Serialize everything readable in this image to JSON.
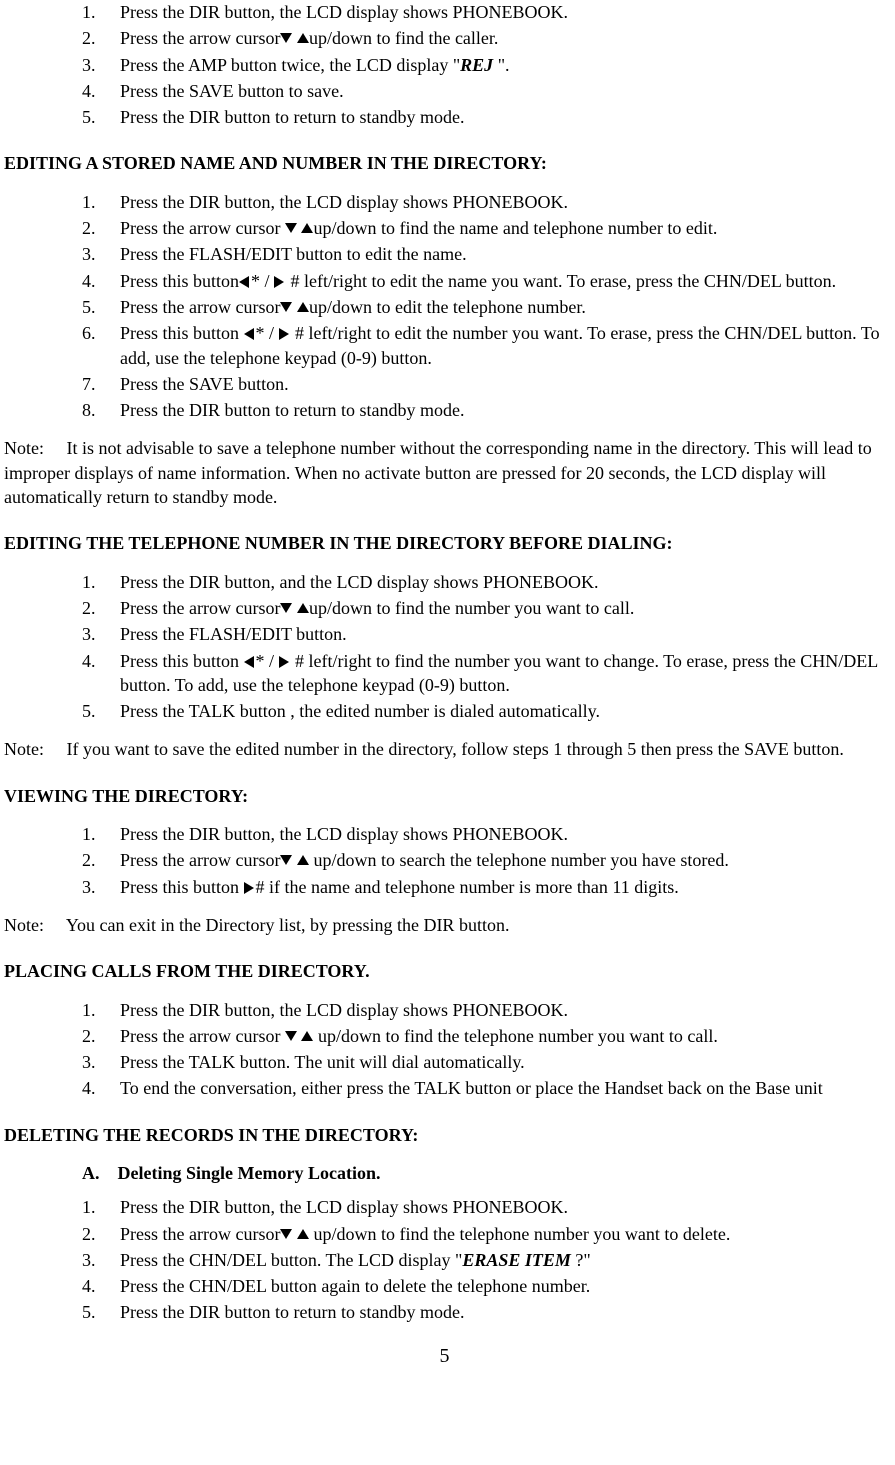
{
  "intro_list": [
    "Press the DIR button, the LCD display shows PHONEBOOK.",
    {
      "pre": "Press the arrow cursor",
      "arrows": "ud",
      "post": "up/down to find the caller."
    },
    {
      "pre": "Press the AMP button twice, the LCD display \"",
      "rej": "REJ",
      "post": " \"."
    },
    "Press the SAVE button to save.",
    "Press the DIR button to return to standby mode."
  ],
  "h1": "EDITING A STORED NAME AND NUMBER IN THE DIRECTORY:",
  "list1": [
    "Press the DIR button, the LCD display shows PHONEBOOK.",
    {
      "pre": "Press the arrow cursor ",
      "arrows": "ud",
      "post": "up/down to find the name and telephone number to edit."
    },
    "Press the FLASH/EDIT button to edit the name.",
    {
      "pre": "Press this button",
      "arrows": "lr",
      "post": " left/right to edit the name you want. To erase, press the CHN/DEL button."
    },
    {
      "pre": "Press the arrow cursor",
      "arrows": "ud",
      "post": "up/down to edit the telephone number."
    },
    {
      "pre": "Press this button ",
      "arrows": "lr",
      "post": " left/right to edit the number you want. To erase, press the CHN/DEL button. To add, use  the telephone keypad (0-9) button."
    },
    "Press the SAVE button.",
    "Press the DIR button to return to standby mode."
  ],
  "note1": "Note:  It is not advisable to save a telephone number without the corresponding name in the directory. This will lead to improper displays of name information. When no activate button are pressed for 20 seconds, the LCD display will automatically return to standby mode.",
  "h2": "EDITING THE TELEPHONE NUMBER IN THE DIRECTORY BEFORE DIALING:",
  "list2": [
    "Press the DIR button, and the LCD display shows PHONEBOOK.",
    {
      "pre": "Press the arrow cursor",
      "arrows": "ud",
      "post": "up/down to find the number you want to call."
    },
    "Press the FLASH/EDIT button.",
    {
      "pre": "Press this button ",
      "arrows": "lr",
      "post": " left/right to find the number you want to change. To erase, press the CHN/DEL button. To add, use the telephone keypad (0-9) button."
    },
    "Press the TALK button , the edited number is dialed automatically."
  ],
  "note2": "Note:  If you want to save the edited number in the directory, follow steps 1 through 5 then press the SAVE button.",
  "h3": "VIEWING THE DIRECTORY:",
  "list3": [
    "Press the DIR button, the LCD display shows PHONEBOOK.",
    {
      "pre": "Press the arrow cursor",
      "arrows": "ud",
      "post": " up/down to search the telephone number you have stored."
    },
    {
      "pre": "Press this button ",
      "arrows": "r#",
      "post": " if the name and telephone number is more than 11 digits."
    }
  ],
  "note3": "Note:  You can exit in the Directory list, by pressing the DIR button.",
  "h4": "PLACING CALLS FROM THE DIRECTORY.",
  "list4": [
    "Press the DIR button, the LCD display shows PHONEBOOK.",
    {
      "pre": "Press the arrow cursor ",
      "arrows": "ud",
      "post": " up/down to find the telephone number you want to call."
    },
    "Press the TALK button. The unit will dial automatically.",
    "To end the conversation, either press the TALK button or place the Handset back on the Base unit"
  ],
  "h5": "DELETING THE RECORDS IN THE DIRECTORY:",
  "sub5": "A. Deleting Single Memory Location.",
  "list5": [
    "Press the DIR button, the LCD display shows PHONEBOOK.",
    {
      "pre": "Press the arrow cursor",
      "arrows": "ud",
      "post": " up/down to find the telephone number you want to delete."
    },
    {
      "pre": "Press the CHN/DEL button. The LCD display \"",
      "rej": "ERASE ITEM ",
      "post": "?\""
    },
    "Press the CHN/DEL button again to delete the telephone number.",
    "Press the DIR button to return to standby mode."
  ],
  "page": "5"
}
